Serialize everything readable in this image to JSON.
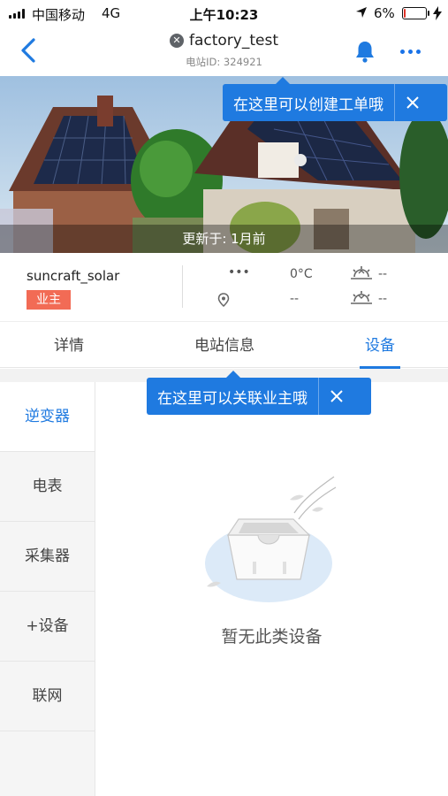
{
  "status_bar": {
    "carrier": "中国移动",
    "network": "4G",
    "time": "上午10:23",
    "battery_percent": "6%",
    "battery_level": 0.06
  },
  "header": {
    "title": "factory_test",
    "title_icon": "close-circle-icon",
    "station_id": "电站ID: 324921"
  },
  "banner": {
    "updated": "更新于: 1月前"
  },
  "tooltips": {
    "create_order": "在这里可以创建工单哦",
    "link_owner": "在这里可以关联业主哦"
  },
  "owner": {
    "name": "suncraft_solar",
    "tag": "业主"
  },
  "weather": {
    "condition": "•••",
    "temperature": "0°C",
    "sunrise": "--",
    "location": "--",
    "sunset": "--"
  },
  "tabs": [
    "详情",
    "电站信息",
    "设备"
  ],
  "sidebar": {
    "items": [
      "逆变器",
      "电表",
      "采集器",
      "+设备",
      "联网"
    ]
  },
  "empty_state": {
    "text": "暂无此类设备"
  },
  "colors": {
    "accent": "#1f7ae0",
    "owner_tag": "#f26b55"
  }
}
